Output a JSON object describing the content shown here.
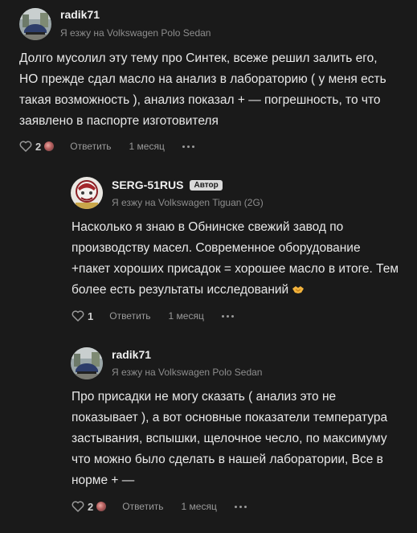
{
  "comments": [
    {
      "author": "radik71",
      "car": "Я езжу на Volkswagen Polo Sedan",
      "badge": "",
      "text": "Долго мусолил эту тему про Синтек, всеже решил залить его, НО прежде сдал масло на анализ в лабораторию ( у меня есть такая возможность ), анализ показал + — погрешность, то что заявлено в паспорте изготовителя",
      "likes": "2",
      "reply": "Ответить",
      "time": "1 месяц"
    },
    {
      "author": "SERG-51RUS",
      "car": "Я езжу на Volkswagen Tiguan (2G)",
      "badge": "Автор",
      "text": "Насколько я знаю в Обнинске свежий завод по производству масел. Современное оборудование +пакет хороших присадок = хорошее масло в итоге. Тем более есть результаты исследований",
      "likes": "1",
      "reply": "Ответить",
      "time": "1 месяц"
    },
    {
      "author": "radik71",
      "car": "Я езжу на Volkswagen Polo Sedan",
      "badge": "",
      "text": "Про присадки не могу сказать ( анализ это не показывает ), а вот основные показатели температура застывания, вспышки, щелочное чесло, по максимуму что можно было сделать в нашей лаборатории, Все в норме + —",
      "likes": "2",
      "reply": "Ответить",
      "time": "1 месяц"
    }
  ],
  "icons": {
    "like": "heart-icon",
    "more": "more-dots-icon",
    "emoji": "handshake-emoji-icon"
  },
  "colors": {
    "background": "#1a1a1a",
    "text": "#e8e8e8",
    "muted": "#8d8d8d"
  }
}
